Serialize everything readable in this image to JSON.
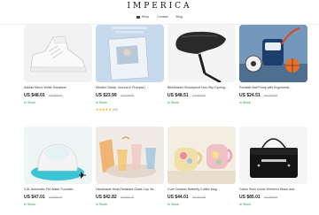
{
  "brand": {
    "name": "IMPERICA"
  },
  "nav": {
    "items": [
      {
        "label": "Shop",
        "icon": "menu-icon"
      },
      {
        "label": "Contact"
      },
      {
        "label": "Blog"
      }
    ]
  },
  "products": [
    {
      "title": "Adidas Men's White Sneakers",
      "price": "US $48.01",
      "original_price": "US $58.00",
      "stock": "In Stock",
      "image": "sneaker"
    },
    {
      "title": "Mindful Clarity: Journal & Prompts | ...",
      "price": "US $23.99",
      "original_price": "US $29.99",
      "stock": "In Stock",
      "rating": "★★★★★",
      "reviews": "(50)",
      "image": "journal"
    },
    {
      "title": "BikeMaster Shockproof Non-Slip Cycling...",
      "price": "US $48.51",
      "original_price": "US $55.40",
      "stock": "In Stock",
      "image": "saddle"
    },
    {
      "title": "Portable Ball Pump with Ergonomic...",
      "price": "US $24.51",
      "original_price": "US $33.69",
      "stock": "In Stock",
      "image": "pump"
    },
    {
      "title": "2.8L Automatic Pet Water Fountain",
      "price": "US $47.01",
      "original_price": "US $56.00",
      "stock": "In Stock",
      "image": "fountain"
    },
    {
      "title": "Handmade Heat-Resistant Glass Cup Se...",
      "price": "US $42.82",
      "original_price": "US $51.38",
      "stock": "In Stock",
      "image": "glasses"
    },
    {
      "title": "Cute Ceramic Butterfly Coffee Mug...",
      "price": "US $44.01",
      "original_price": "US $54.99",
      "stock": "In Stock",
      "image": "mugs"
    },
    {
      "title": "Calvin Klein Iconic Women's Black and...",
      "price": "US $85.01",
      "original_price": "US $99.99",
      "stock": "In Stock",
      "image": "bag"
    }
  ],
  "colors": {
    "in_stock": "#1e9b4a",
    "star": "#f2a900"
  }
}
